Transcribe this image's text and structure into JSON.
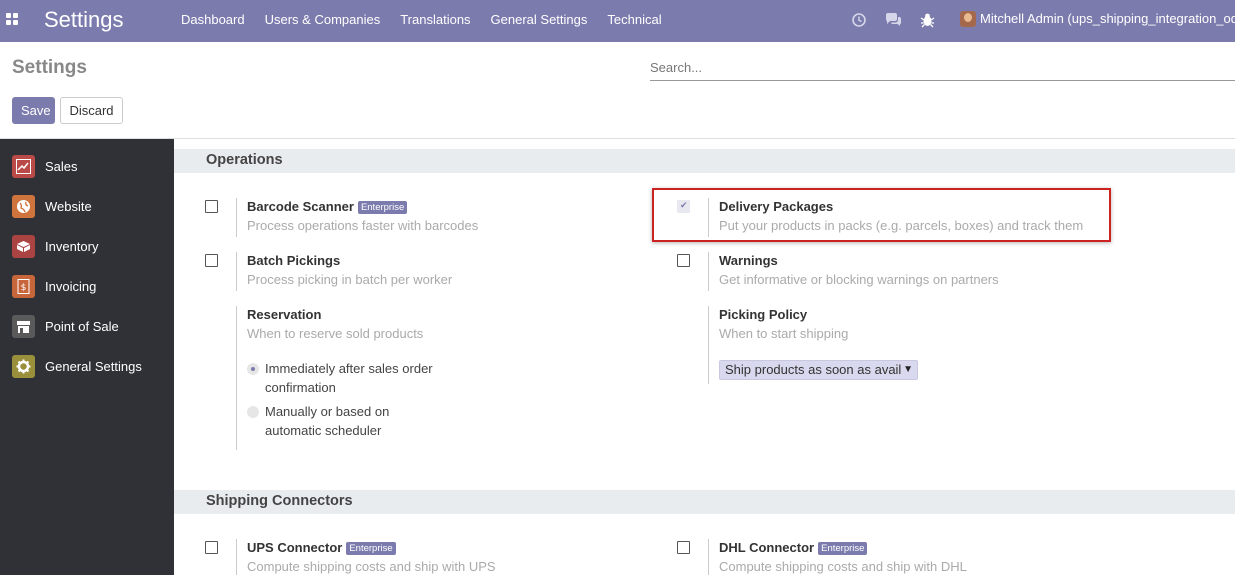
{
  "topbar": {
    "app_title": "Settings",
    "menu": [
      "Dashboard",
      "Users & Companies",
      "Translations",
      "General Settings",
      "Technical"
    ],
    "user_name": "Mitchell Admin (ups_shipping_integration_od",
    "icons": [
      "clock-icon",
      "chat-icon",
      "bug-icon"
    ]
  },
  "control_panel": {
    "breadcrumb": "Settings",
    "search_placeholder": "Search...",
    "save_label": "Save",
    "discard_label": "Discard"
  },
  "sidebar": {
    "items": [
      {
        "label": "Sales",
        "color": "#b94a48"
      },
      {
        "label": "Website",
        "color": "#d0743d"
      },
      {
        "label": "Inventory",
        "color": "#a94442"
      },
      {
        "label": "Invoicing",
        "color": "#c8663b"
      },
      {
        "label": "Point of Sale",
        "color": "#5a5a5a"
      },
      {
        "label": "General Settings",
        "color": "#9a8f3a"
      }
    ]
  },
  "sections": {
    "operations": {
      "title": "Operations",
      "barcode": {
        "title": "Barcode Scanner",
        "badge": "Enterprise",
        "desc": "Process operations faster with barcodes",
        "checked": false
      },
      "delivery": {
        "title": "Delivery Packages",
        "desc": "Put your products in packs (e.g. parcels, boxes) and track them",
        "checked": true
      },
      "batch": {
        "title": "Batch Pickings",
        "desc": "Process picking in batch per worker",
        "checked": false
      },
      "warnings": {
        "title": "Warnings",
        "desc": "Get informative or blocking warnings on partners",
        "checked": false
      },
      "reservation": {
        "title": "Reservation",
        "desc": "When to reserve sold products",
        "options": [
          {
            "line1": "Immediately after sales order",
            "line2": "confirmation",
            "selected": true
          },
          {
            "line1": "Manually or based on",
            "line2": "automatic scheduler",
            "selected": false
          }
        ]
      },
      "picking_policy": {
        "title": "Picking Policy",
        "desc": "When to start shipping",
        "selected": "Ship products as soon as avail"
      }
    },
    "shipping": {
      "title": "Shipping Connectors",
      "ups": {
        "title": "UPS Connector",
        "badge": "Enterprise",
        "desc": "Compute shipping costs and ship with UPS",
        "checked": false
      },
      "dhl": {
        "title": "DHL Connector",
        "badge": "Enterprise",
        "desc": "Compute shipping costs and ship with DHL",
        "checked": false
      }
    }
  },
  "colors": {
    "brand": "#7c7bad",
    "sidebar_bg": "#2f3136",
    "highlight": "#cc2222"
  }
}
